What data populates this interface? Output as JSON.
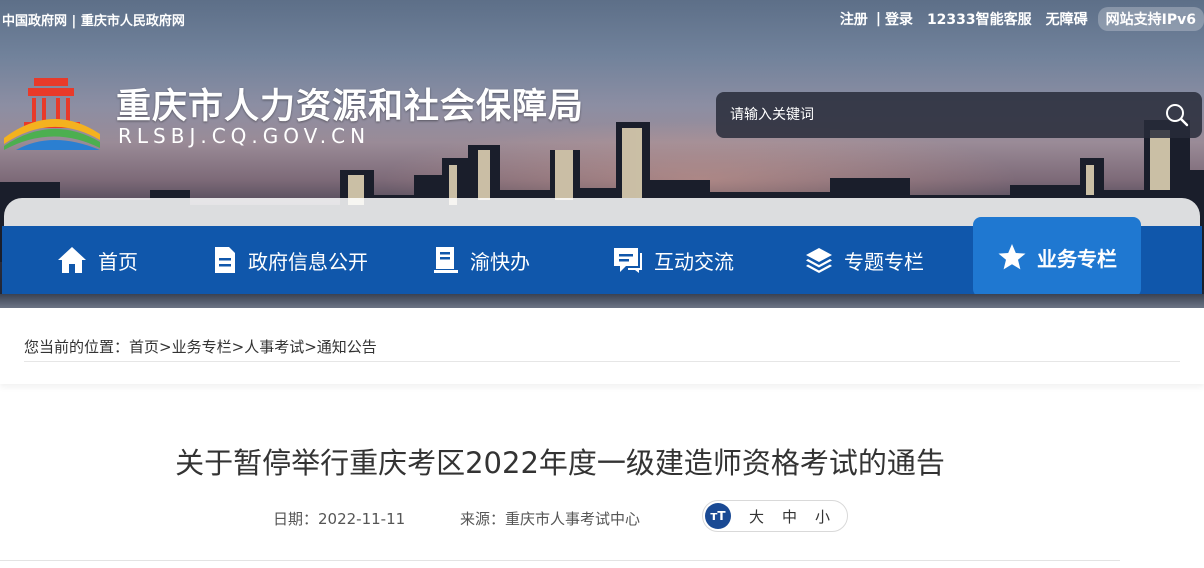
{
  "top_bar": {
    "gov_link": "中国政府网",
    "separator": "|",
    "city_link": "重庆市人民政府网",
    "register": "注册",
    "login": "登录",
    "service": "12333智能客服",
    "accessibility": "无障碍",
    "ipv6": "网站支持IPv6"
  },
  "header": {
    "title": "重庆市人力资源和社会保障局",
    "domain": "RLSBJ.CQ.GOV.CN",
    "search_placeholder": "请输入关键词"
  },
  "nav": {
    "items": [
      {
        "label": "首页",
        "icon": "home-icon"
      },
      {
        "label": "政府信息公开",
        "icon": "document-icon"
      },
      {
        "label": "渝快办",
        "icon": "book-icon"
      },
      {
        "label": "互动交流",
        "icon": "chat-icon"
      },
      {
        "label": "专题专栏",
        "icon": "layers-icon"
      },
      {
        "label": "业务专栏",
        "icon": "star-icon",
        "active": true
      }
    ]
  },
  "breadcrumb": {
    "prefix": "您当前的位置：",
    "items": [
      "首页",
      "业务专栏",
      "人事考试",
      "通知公告"
    ],
    "separator": ">"
  },
  "article": {
    "title": "关于暂停举行重庆考区2022年度一级建造师资格考试的通告",
    "date_label": "日期：2022-11-11",
    "source_label": "来源：重庆市人事考试中心",
    "font_sizes": [
      "大",
      "中",
      "小"
    ],
    "font_toggle": "тT"
  },
  "colors": {
    "nav_bg": "#1057ab",
    "nav_active": "#1f78d1",
    "text": "#333333"
  }
}
